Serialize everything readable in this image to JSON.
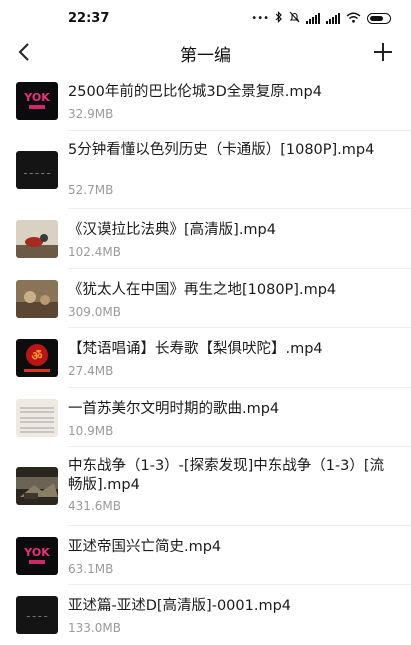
{
  "status_bar": {
    "time": "22:37",
    "network_type": "4G"
  },
  "nav": {
    "title": "第一编",
    "back_icon": "chevron-left-icon",
    "add_icon": "plus-icon"
  },
  "files": [
    {
      "name": "2500年前的巴比伦城3D全景复原.mp4",
      "size": "32.9MB",
      "thumb": "logo-pink"
    },
    {
      "name": "5分钟看懂以色列历史（卡通版）[1080P].mp4",
      "size": "52.7MB",
      "thumb": "dark-text"
    },
    {
      "name": "《汉谟拉比法典》[高清版].mp4",
      "size": "102.4MB",
      "thumb": "painting-red"
    },
    {
      "name": "《犹太人在中国》再生之地[1080P].mp4",
      "size": "309.0MB",
      "thumb": "sepia"
    },
    {
      "name": "【梵语唱诵】长寿歌【梨俱吠陀】.mp4",
      "size": "27.4MB",
      "thumb": "om-red"
    },
    {
      "name": "一首苏美尔文明时期的歌曲.mp4",
      "size": "10.9MB",
      "thumb": "sheet-music"
    },
    {
      "name": "中东战争（1-3）-[探索发现]中东战争（1-3）[流畅版].mp4",
      "size": "431.6MB",
      "thumb": "war-scene"
    },
    {
      "name": "亚述帝国兴亡简史.mp4",
      "size": "63.1MB",
      "thumb": "logo-pink"
    },
    {
      "name": "亚述篇-亚述D[高清版]-0001.mp4",
      "size": "133.0MB",
      "thumb": "dark-text"
    }
  ]
}
